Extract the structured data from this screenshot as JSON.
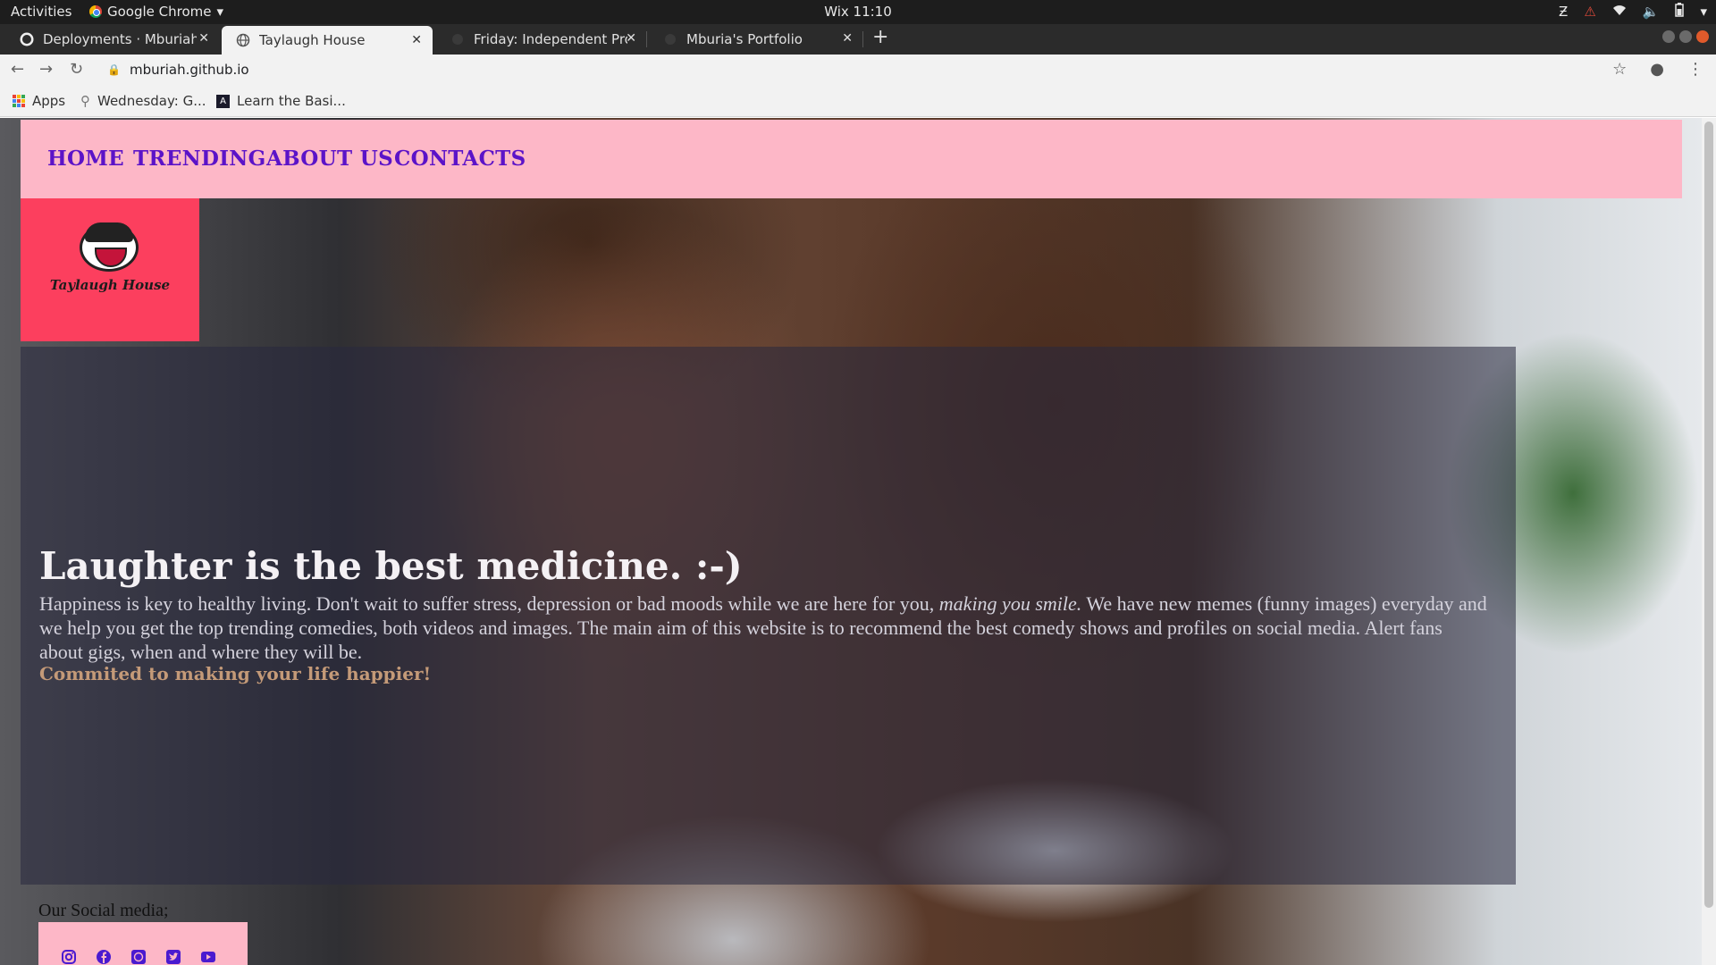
{
  "system": {
    "activities": "Activities",
    "app_name": "Google Chrome",
    "clock": "Wix 11:10"
  },
  "tabs": [
    {
      "title": "Deployments · Mburiah/m",
      "icon": "github-icon",
      "active": false
    },
    {
      "title": "Taylaugh House",
      "icon": "globe-icon",
      "active": true
    },
    {
      "title": "Friday: Independent Proje",
      "icon": "page-icon",
      "active": false
    },
    {
      "title": "Mburia's Portfolio",
      "icon": "page-icon",
      "active": false
    }
  ],
  "address": {
    "url": "mburiah.github.io"
  },
  "bookmarks": [
    {
      "label": "Apps"
    },
    {
      "label": "Wednesday: G..."
    },
    {
      "label": "Learn the Basi..."
    }
  ],
  "site": {
    "nav": [
      "HOME",
      "TRENDING",
      "ABOUT US",
      "CONTACTS"
    ],
    "logo_text": "Taylaugh House",
    "headline": "Laughter is the best medicine. :-)",
    "paragraph_part1": "Happiness is key to healthy living. Don't wait to suffer stress, depression or bad moods while we are here for you, ",
    "paragraph_italic": "making you smile.",
    "paragraph_part2": " We have new memes (funny images) everyday and we help you get the top trending comedies, both videos and images. The main aim of this website is to recommend the best comedy shows and profiles on social media. Alert fans about gigs, when and where they will be.",
    "tagline": "Commited to making your life happier!",
    "social_label": "Our Social media;",
    "social_icons": [
      "instagram-icon",
      "facebook-icon",
      "whatsapp-icon",
      "twitter-icon",
      "youtube-icon"
    ]
  },
  "colors": {
    "nav_bg": "#fdb7c7",
    "nav_link": "#5b13c8",
    "logo_bg": "#fc3f5e",
    "tagline": "#c49a78"
  }
}
